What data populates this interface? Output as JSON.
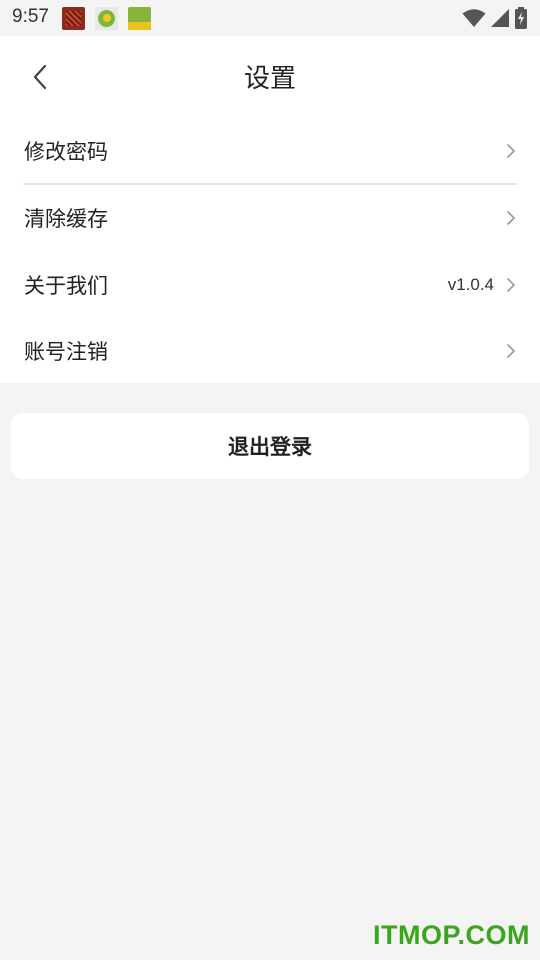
{
  "status_bar": {
    "time": "9:57",
    "notifications": [
      "app-notification-icon",
      "app-notification-icon",
      "app-notification-icon"
    ],
    "icons": [
      "wifi-icon",
      "signal-icon",
      "battery-charging-icon"
    ]
  },
  "header": {
    "back_icon": "chevron-left-icon",
    "title": "设置"
  },
  "menu": {
    "items": [
      {
        "label": "修改密码",
        "value": ""
      },
      {
        "label": "清除缓存",
        "value": ""
      },
      {
        "label": "关于我们",
        "value": "v1.0.4"
      },
      {
        "label": "账号注销",
        "value": ""
      }
    ]
  },
  "logout": {
    "label": "退出登录"
  },
  "watermark": {
    "text": "ITMOP.COM"
  },
  "colors": {
    "background": "#f4f4f4",
    "surface": "#ffffff",
    "text": "#222222",
    "divider": "#e3e3e3",
    "watermark": "#3aa61c"
  }
}
